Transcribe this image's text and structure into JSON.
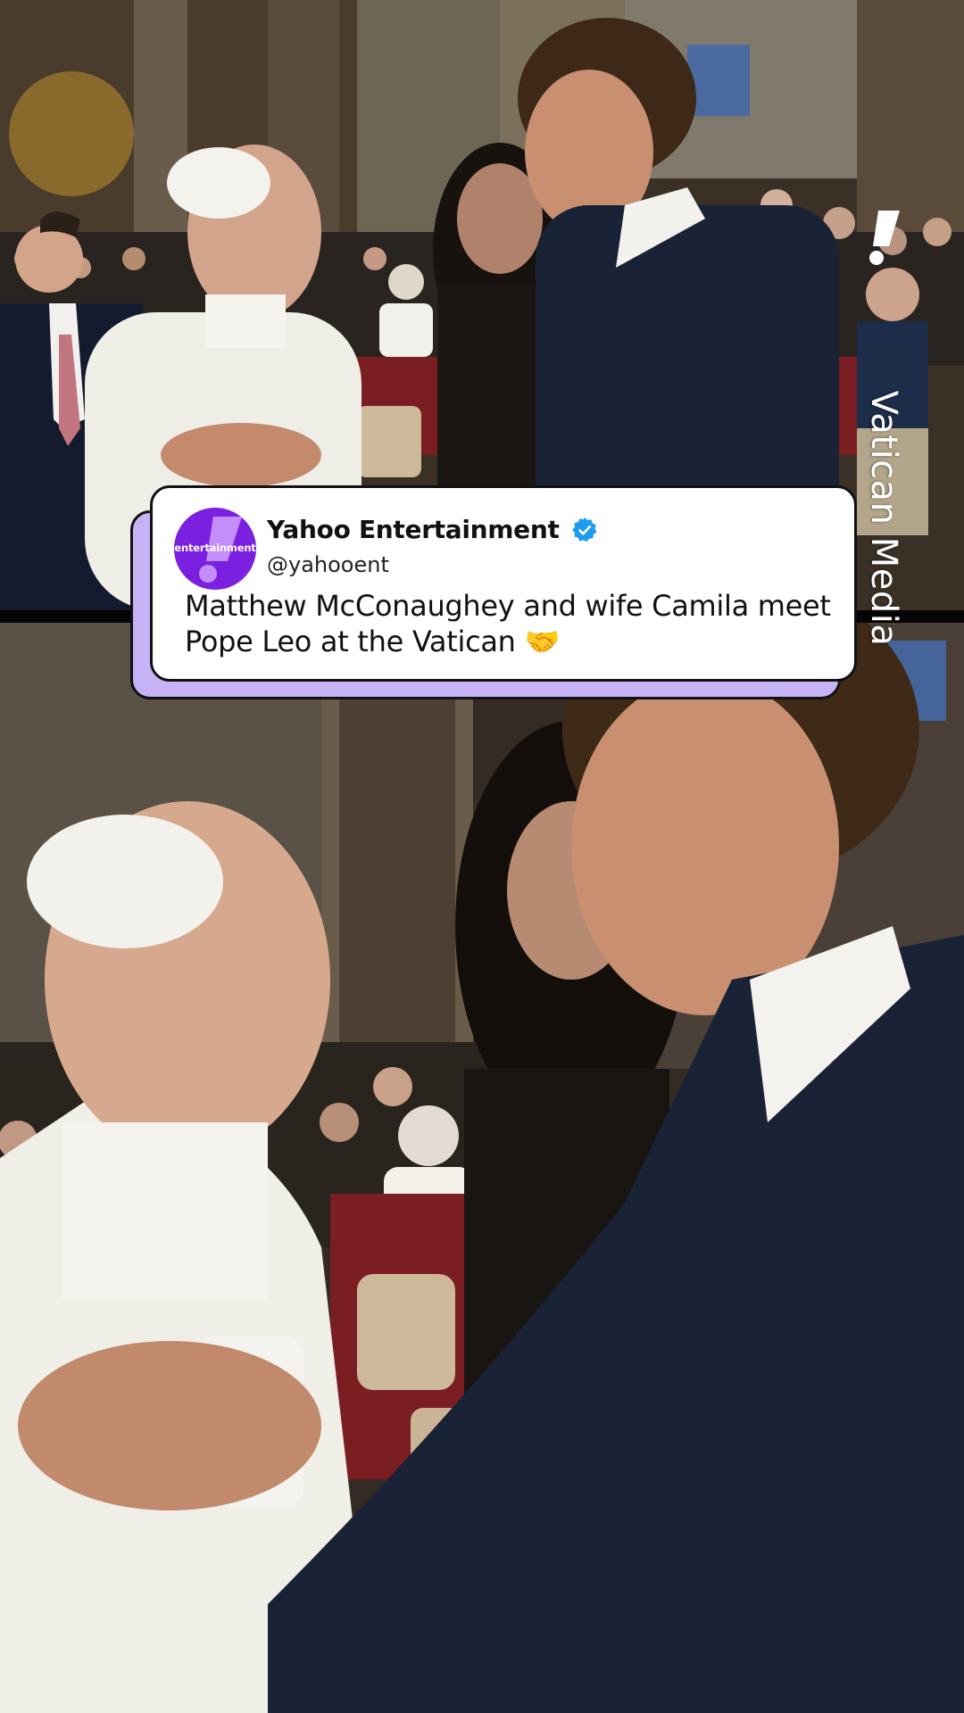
{
  "watermark": {
    "brand_text": "Vatican Media",
    "logo_icon": "yahoo-exclamation-icon",
    "color": "#ffffff"
  },
  "post": {
    "author": "Yahoo Entertainment",
    "handle": "@yahooent",
    "avatar_label": "entertainment",
    "avatar_icon": "yahoo-exclamation-icon",
    "verified_icon": "verified-check-icon",
    "text": "Matthew McConaughey and wife Camila meet Pope Leo at the Vatican 🤝",
    "colors": {
      "card_background": "#ffffff",
      "card_accent": "#c5b3f5",
      "avatar_background": "#7b1fe0",
      "verified_badge": "#1d9bf0"
    }
  }
}
